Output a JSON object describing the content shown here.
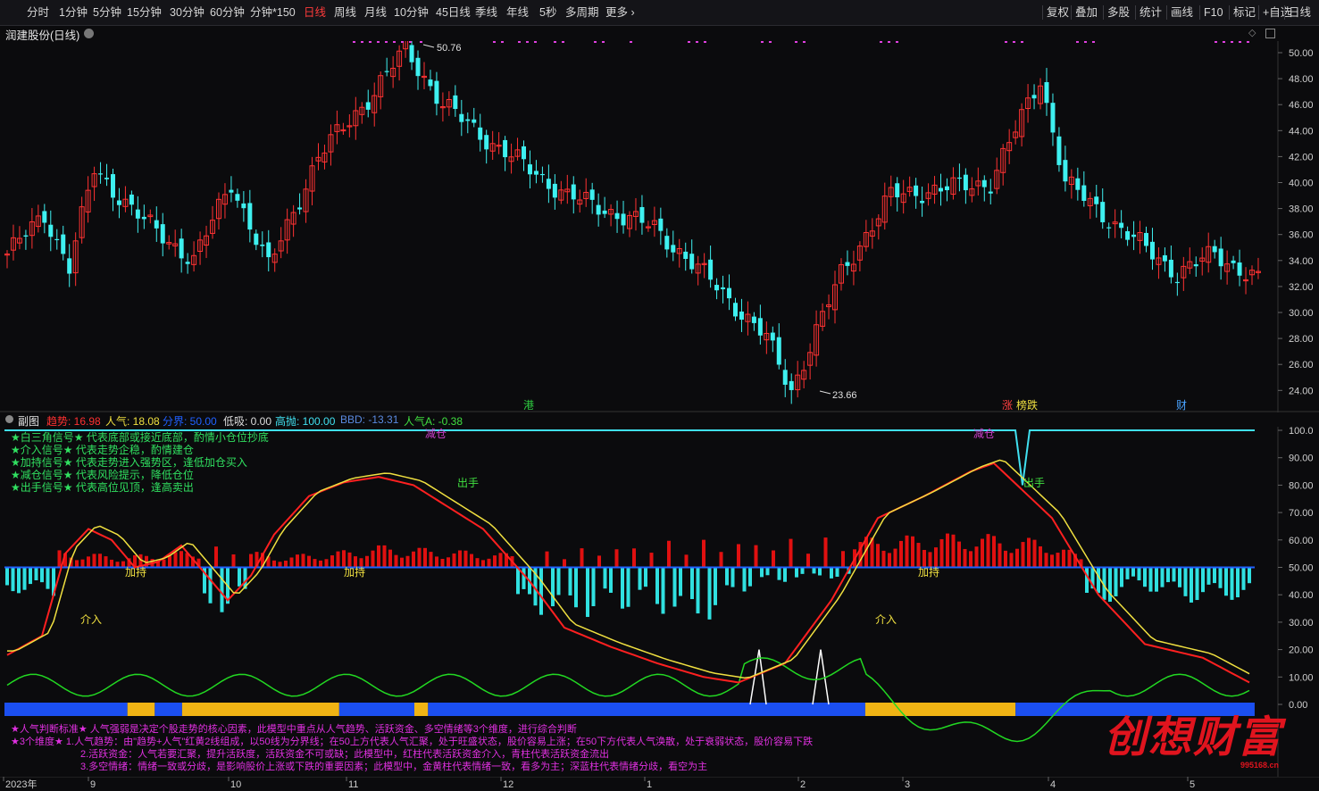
{
  "toolbar": {
    "left": [
      "分时",
      "1分钟",
      "5分钟",
      "15分钟",
      "30分钟",
      "60分钟",
      "分钟*150",
      "日线",
      "周线",
      "月线",
      "10分钟",
      "45日线",
      "季线",
      "年线",
      "5秒",
      "多周期",
      "更多 ›"
    ],
    "active": "日线",
    "right": [
      "复权",
      "叠加",
      "多股",
      "统计",
      "画线",
      "F10",
      "标记",
      "+自选",
      "日线"
    ]
  },
  "stock": {
    "name": "润建股份(日线)"
  },
  "main_chart": {
    "y_ticks": [
      "50.00",
      "48.00",
      "46.00",
      "44.00",
      "42.00",
      "40.00",
      "38.00",
      "36.00",
      "34.00",
      "32.00",
      "30.00",
      "28.00",
      "26.00",
      "24.00"
    ],
    "y_values": [
      50,
      48,
      46,
      44,
      42,
      40,
      38,
      36,
      34,
      32,
      30,
      28,
      26,
      24
    ],
    "high_label": "50.76",
    "low_label": "23.66",
    "event_labels": [
      {
        "text": "港",
        "color": "#2ecc40"
      },
      {
        "text": "涨",
        "color": "#ff4040"
      },
      {
        "text": "榜跌",
        "color": "#f0e040"
      },
      {
        "text": "财",
        "color": "#4aa3ff"
      }
    ]
  },
  "chart_data": {
    "type": "candlestick",
    "ylim": [
      23,
      51
    ],
    "high": 50.76,
    "low": 23.66,
    "anchors": [
      [
        0,
        34.5
      ],
      [
        6,
        37.5
      ],
      [
        10,
        33.5
      ],
      [
        14,
        41
      ],
      [
        22,
        37
      ],
      [
        30,
        34
      ],
      [
        36,
        40
      ],
      [
        42,
        33.5
      ],
      [
        50,
        42
      ],
      [
        59,
        47
      ],
      [
        64,
        50.3
      ],
      [
        70,
        46
      ],
      [
        78,
        43
      ],
      [
        90,
        39
      ],
      [
        104,
        36.5
      ],
      [
        114,
        32
      ],
      [
        122,
        28
      ],
      [
        126,
        24
      ],
      [
        134,
        33
      ],
      [
        142,
        39
      ],
      [
        158,
        40
      ],
      [
        166,
        48
      ],
      [
        170,
        40
      ],
      [
        180,
        36
      ],
      [
        188,
        33
      ],
      [
        194,
        34.5
      ],
      [
        201,
        32.5
      ]
    ]
  },
  "sub_chart": {
    "title": "副图",
    "indicators": [
      {
        "label": "趋势: 16.98",
        "color": "#ff3030"
      },
      {
        "label": "人气: 18.08",
        "color": "#f0e040"
      },
      {
        "label": "分界: 50.00",
        "color": "#2060ff"
      },
      {
        "label": "低吸: 0.00",
        "color": "#dddddd"
      },
      {
        "label": "高抛: 100.00",
        "color": "#40e0f0"
      },
      {
        "label": "BBD: -13.31",
        "color": "#5a8ae0"
      },
      {
        "label": "人气A: -0.38",
        "color": "#40e040"
      }
    ],
    "y_ticks": [
      "100.0",
      "90.00",
      "80.00",
      "70.00",
      "60.00",
      "50.00",
      "40.00",
      "30.00",
      "20.00",
      "10.00",
      "0.00"
    ],
    "y_values": [
      100,
      90,
      80,
      70,
      60,
      50,
      40,
      30,
      20,
      10,
      0
    ],
    "signals": [
      {
        "text": "减仓",
        "color": "#d040d0"
      },
      {
        "text": "减仓",
        "color": "#d040d0"
      },
      {
        "text": "出手",
        "color": "#40e040"
      },
      {
        "text": "出手",
        "color": "#40e040"
      },
      {
        "text": "介入",
        "color": "#f0e040"
      },
      {
        "text": "介入",
        "color": "#f0e040"
      },
      {
        "text": "加持",
        "color": "#f0e040"
      },
      {
        "text": "加持",
        "color": "#f0e040"
      },
      {
        "text": "加持",
        "color": "#f0e040"
      }
    ],
    "legend": [
      "★白三角信号★ 代表底部或接近底部，酌情小仓位抄底",
      "★介入信号★ 代表走势企稳，酌情建仓",
      "★加持信号★ 代表走势进入强势区，逢低加仓买入",
      "★减仓信号★ 代表风险提示，降低仓位",
      "★出手信号★ 代表高位见顶，逢高卖出"
    ],
    "notes": [
      "★人气判断标准★ 人气强弱是决定个股走势的核心因素，此模型中重点从人气趋势、活跃资金、多空情绪等3个维度，进行综合判断",
      "★3个维度★ 1.人气趋势：由\"趋势+人气\"红黄2线组成，以50线为分界线；在50上方代表人气汇聚，处于旺盛状态，股价容易上涨；在50下方代表人气涣散，处于衰弱状态，股价容易下跌",
      "2.活跃资金：人气若要汇聚，提升活跃度，活跃资金不可或缺；此模型中，红柱代表活跃资金介入，青柱代表活跃资金流出",
      "3.多空情绪：情绪一致或分歧，是影响股价上涨或下跌的重要因素；此模型中，金黄柱代表情绪一致，看多为主；深蓝柱代表情绪分歧，看空为主"
    ],
    "trend_anchors": [
      [
        0,
        18
      ],
      [
        6,
        25
      ],
      [
        10,
        55
      ],
      [
        14,
        64
      ],
      [
        18,
        60
      ],
      [
        22,
        50
      ],
      [
        26,
        52
      ],
      [
        30,
        58
      ],
      [
        34,
        48
      ],
      [
        38,
        38
      ],
      [
        42,
        47
      ],
      [
        46,
        62
      ],
      [
        52,
        76
      ],
      [
        58,
        81
      ],
      [
        64,
        83
      ],
      [
        70,
        80
      ],
      [
        76,
        72
      ],
      [
        82,
        64
      ],
      [
        90,
        45
      ],
      [
        96,
        28
      ],
      [
        104,
        21
      ],
      [
        112,
        15
      ],
      [
        120,
        10
      ],
      [
        126,
        8
      ],
      [
        134,
        15
      ],
      [
        142,
        38
      ],
      [
        150,
        68
      ],
      [
        158,
        76
      ],
      [
        166,
        85
      ],
      [
        170,
        88
      ],
      [
        174,
        80
      ],
      [
        180,
        68
      ],
      [
        188,
        40
      ],
      [
        196,
        22
      ],
      [
        206,
        17
      ],
      [
        214,
        8
      ]
    ],
    "red_bars": [
      [
        8,
        45
      ],
      [
        20,
        30
      ],
      [
        30,
        42
      ],
      [
        38,
        60
      ],
      [
        46,
        30
      ],
      [
        56,
        40
      ],
      [
        64,
        58
      ],
      [
        88,
        35
      ],
      [
        114,
        70
      ],
      [
        152,
        80
      ],
      [
        166,
        90
      ],
      [
        180,
        70
      ],
      [
        186,
        20
      ],
      [
        196,
        25
      ],
      [
        206,
        12
      ]
    ],
    "cyan_bars": [
      [
        0,
        25
      ],
      [
        14,
        35
      ],
      [
        24,
        42
      ],
      [
        34,
        50
      ],
      [
        42,
        40
      ],
      [
        50,
        32
      ],
      [
        60,
        28
      ],
      [
        72,
        38
      ],
      [
        86,
        48
      ],
      [
        100,
        52
      ],
      [
        108,
        40
      ],
      [
        120,
        60
      ],
      [
        128,
        20
      ],
      [
        140,
        10
      ],
      [
        172,
        38
      ],
      [
        184,
        58
      ],
      [
        194,
        20
      ],
      [
        204,
        36
      ],
      [
        214,
        32
      ]
    ],
    "sentiment": [
      {
        "from": 0,
        "to": 18,
        "color": "#1b4ff0"
      },
      {
        "from": 18,
        "to": 22,
        "color": "#f0b414"
      },
      {
        "from": 22,
        "to": 26,
        "color": "#1b4ff0"
      },
      {
        "from": 26,
        "to": 49,
        "color": "#f0b414"
      },
      {
        "from": 49,
        "to": 60,
        "color": "#1b4ff0"
      },
      {
        "from": 60,
        "to": 62,
        "color": "#f0b414"
      },
      {
        "from": 62,
        "to": 126,
        "color": "#1b4ff0"
      },
      {
        "from": 126,
        "to": 148,
        "color": "#f0b414"
      },
      {
        "from": 148,
        "to": 183,
        "color": "#1b4ff0"
      }
    ]
  },
  "x_axis": {
    "labels": [
      "2023年",
      "9",
      "10",
      "11",
      "12",
      "1",
      "2",
      "3",
      "4",
      "5"
    ]
  },
  "logo": {
    "text": "创想财富",
    "url": "995168.cn"
  }
}
